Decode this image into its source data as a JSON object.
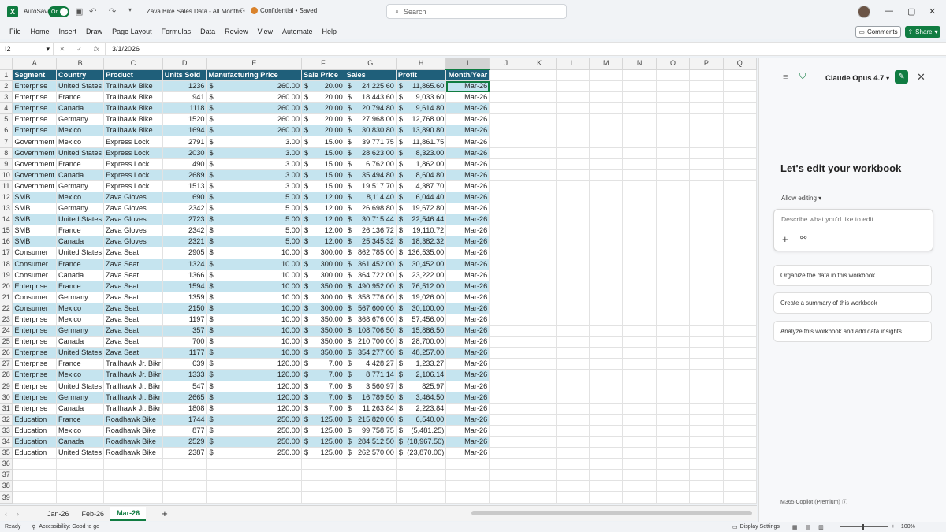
{
  "titlebar": {
    "autosave_label": "AutoSave",
    "autosave_state": "On",
    "doc_title": "Zava Bike Sales Data - All Months",
    "sensitivity": "Confidential • Saved",
    "search_placeholder": "Search"
  },
  "menu": [
    "File",
    "Home",
    "Insert",
    "Draw",
    "Page Layout",
    "Formulas",
    "Data",
    "Review",
    "View",
    "Automate",
    "Help"
  ],
  "ribbon_buttons": {
    "comments": "Comments",
    "share": "Share"
  },
  "formula_bar": {
    "name_box": "I2",
    "fx": "fx",
    "value": "3/1/2026"
  },
  "columns": [
    "A",
    "B",
    "C",
    "D",
    "E",
    "F",
    "G",
    "H",
    "I",
    "J",
    "K",
    "L",
    "M",
    "N",
    "O",
    "P",
    "Q"
  ],
  "headers": [
    "Segment",
    "Country",
    "Product",
    "Units Sold",
    "Manufacturing Price",
    "Sale Price",
    "Sales",
    "Profit",
    "Month/Year"
  ],
  "rows": [
    [
      "Enterprise",
      "United States",
      "Trailhawk Bike",
      "1236",
      "260.00",
      "20.00",
      "24,225.60",
      "11,865.60",
      "Mar-26"
    ],
    [
      "Enterprise",
      "France",
      "Trailhawk Bike",
      "941",
      "260.00",
      "20.00",
      "18,443.60",
      "9,033.60",
      "Mar-26"
    ],
    [
      "Enterprise",
      "Canada",
      "Trailhawk Bike",
      "1118",
      "260.00",
      "20.00",
      "20,794.80",
      "9,614.80",
      "Mar-26"
    ],
    [
      "Enterprise",
      "Germany",
      "Trailhawk Bike",
      "1520",
      "260.00",
      "20.00",
      "27,968.00",
      "12,768.00",
      "Mar-26"
    ],
    [
      "Enterprise",
      "Mexico",
      "Trailhawk Bike",
      "1694",
      "260.00",
      "20.00",
      "30,830.80",
      "13,890.80",
      "Mar-26"
    ],
    [
      "Government",
      "Mexico",
      "Express Lock",
      "2791",
      "3.00",
      "15.00",
      "39,771.75",
      "11,861.75",
      "Mar-26"
    ],
    [
      "Government",
      "United States",
      "Express Lock",
      "2030",
      "3.00",
      "15.00",
      "28,623.00",
      "8,323.00",
      "Mar-26"
    ],
    [
      "Government",
      "France",
      "Express Lock",
      "490",
      "3.00",
      "15.00",
      "6,762.00",
      "1,862.00",
      "Mar-26"
    ],
    [
      "Government",
      "Canada",
      "Express Lock",
      "2689",
      "3.00",
      "15.00",
      "35,494.80",
      "8,604.80",
      "Mar-26"
    ],
    [
      "Government",
      "Germany",
      "Express Lock",
      "1513",
      "3.00",
      "15.00",
      "19,517.70",
      "4,387.70",
      "Mar-26"
    ],
    [
      "SMB",
      "Mexico",
      "Zava Gloves",
      "690",
      "5.00",
      "12.00",
      "8,114.40",
      "6,044.40",
      "Mar-26"
    ],
    [
      "SMB",
      "Germany",
      "Zava Gloves",
      "2342",
      "5.00",
      "12.00",
      "26,698.80",
      "19,672.80",
      "Mar-26"
    ],
    [
      "SMB",
      "United States",
      "Zava Gloves",
      "2723",
      "5.00",
      "12.00",
      "30,715.44",
      "22,546.44",
      "Mar-26"
    ],
    [
      "SMB",
      "France",
      "Zava Gloves",
      "2342",
      "5.00",
      "12.00",
      "26,136.72",
      "19,110.72",
      "Mar-26"
    ],
    [
      "SMB",
      "Canada",
      "Zava Gloves",
      "2321",
      "5.00",
      "12.00",
      "25,345.32",
      "18,382.32",
      "Mar-26"
    ],
    [
      "Consumer",
      "United States",
      "Zava Seat",
      "2905",
      "10.00",
      "300.00",
      "862,785.00",
      "136,535.00",
      "Mar-26"
    ],
    [
      "Consumer",
      "France",
      "Zava Seat",
      "1324",
      "10.00",
      "300.00",
      "361,452.00",
      "30,452.00",
      "Mar-26"
    ],
    [
      "Consumer",
      "Canada",
      "Zava Seat",
      "1366",
      "10.00",
      "300.00",
      "364,722.00",
      "23,222.00",
      "Mar-26"
    ],
    [
      "Enterprise",
      "France",
      "Zava Seat",
      "1594",
      "10.00",
      "350.00",
      "490,952.00",
      "76,512.00",
      "Mar-26"
    ],
    [
      "Consumer",
      "Germany",
      "Zava Seat",
      "1359",
      "10.00",
      "300.00",
      "358,776.00",
      "19,026.00",
      "Mar-26"
    ],
    [
      "Consumer",
      "Mexico",
      "Zava Seat",
      "2150",
      "10.00",
      "300.00",
      "567,600.00",
      "30,100.00",
      "Mar-26"
    ],
    [
      "Enterprise",
      "Mexico",
      "Zava Seat",
      "1197",
      "10.00",
      "350.00",
      "368,676.00",
      "57,456.00",
      "Mar-26"
    ],
    [
      "Enterprise",
      "Germany",
      "Zava Seat",
      "357",
      "10.00",
      "350.00",
      "108,706.50",
      "15,886.50",
      "Mar-26"
    ],
    [
      "Enterprise",
      "Canada",
      "Zava Seat",
      "700",
      "10.00",
      "350.00",
      "210,700.00",
      "28,700.00",
      "Mar-26"
    ],
    [
      "Enterprise",
      "United States",
      "Zava Seat",
      "1177",
      "10.00",
      "350.00",
      "354,277.00",
      "48,257.00",
      "Mar-26"
    ],
    [
      "Enterprise",
      "France",
      "Trailhawk Jr. Bikr",
      "639",
      "120.00",
      "7.00",
      "4,428.27",
      "1,233.27",
      "Mar-26"
    ],
    [
      "Enterprise",
      "Mexico",
      "Trailhawk Jr. Bikr",
      "1333",
      "120.00",
      "7.00",
      "8,771.14",
      "2,106.14",
      "Mar-26"
    ],
    [
      "Enterprise",
      "United States",
      "Trailhawk Jr. Bikr",
      "547",
      "120.00",
      "7.00",
      "3,560.97",
      "825.97",
      "Mar-26"
    ],
    [
      "Enterprise",
      "Germany",
      "Trailhawk Jr. Bikr",
      "2665",
      "120.00",
      "7.00",
      "16,789.50",
      "3,464.50",
      "Mar-26"
    ],
    [
      "Enterprise",
      "Canada",
      "Trailhawk Jr. Bikr",
      "1808",
      "120.00",
      "7.00",
      "11,263.84",
      "2,223.84",
      "Mar-26"
    ],
    [
      "Education",
      "France",
      "Roadhawk Bike",
      "1744",
      "250.00",
      "125.00",
      "215,820.00",
      "6,540.00",
      "Mar-26"
    ],
    [
      "Education",
      "Mexico",
      "Roadhawk Bike",
      "877",
      "250.00",
      "125.00",
      "99,758.75",
      "(5,481.25)",
      "Mar-26"
    ],
    [
      "Education",
      "Canada",
      "Roadhawk Bike",
      "2529",
      "250.00",
      "125.00",
      "284,512.50",
      "(18,967.50)",
      "Mar-26"
    ],
    [
      "Education",
      "United States",
      "Roadhawk Bike",
      "2387",
      "250.00",
      "125.00",
      "262,570.00",
      "(23,870.00)",
      "Mar-26"
    ]
  ],
  "currency_symbol": "$",
  "sheets": [
    "Jan-26",
    "Feb-26",
    "Mar-26"
  ],
  "active_sheet": "Mar-26",
  "status": {
    "ready": "Ready",
    "accessibility": "Accessibility: Good to go",
    "display": "Display Settings",
    "zoom": "100%"
  },
  "copilot": {
    "model": "Claude Opus 4.7",
    "heading": "Let's edit your workbook",
    "allow": "Allow editing",
    "input_placeholder": "Describe what you'd like to edit.",
    "suggestions": [
      "Organize the data in this workbook",
      "Create a summary of this workbook",
      "Analyze this workbook and add data insights"
    ],
    "footer": "M365 Copilot (Premium)"
  },
  "colors": {
    "accent": "#107c41",
    "header_fill": "#1f5f7a",
    "band_fill": "#c5e4ef"
  }
}
